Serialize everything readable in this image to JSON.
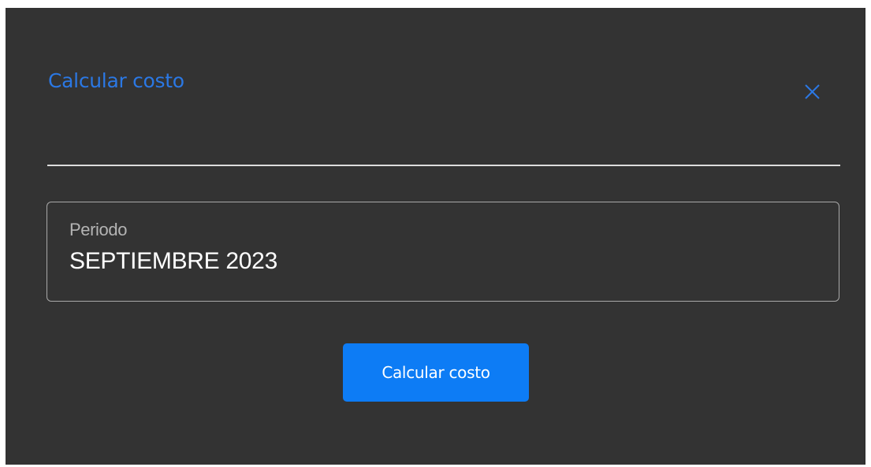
{
  "dialog": {
    "title": "Calcular costo",
    "close_icon": "close-icon",
    "accent_color": "#2b78e4",
    "background_color": "#333333"
  },
  "period_field": {
    "label": "Periodo",
    "value": "SEPTIEMBRE 2023"
  },
  "actions": {
    "calculate_label": "Calcular costo",
    "button_color": "#0d7cf5"
  }
}
